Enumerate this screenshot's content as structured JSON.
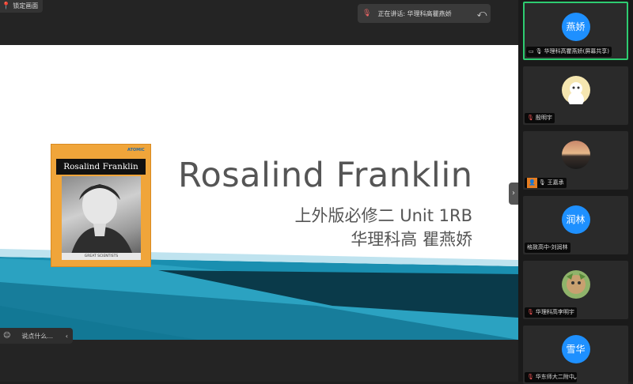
{
  "top_left": {
    "label": "锁定画面"
  },
  "speaking": {
    "label": "正在讲话: 华理科高瞿燕娇"
  },
  "slide": {
    "title": "Rosalind Franklin",
    "subtitle_line1": "上外版必修二 Unit 1RB",
    "subtitle_line2": "华理科高 瞿燕娇",
    "book": {
      "banner": "Rosalind Franklin",
      "tag": "ATOMIC",
      "caption": "GREAT SCIENTISTS"
    }
  },
  "chat": {
    "label": "说点什么..."
  },
  "participants": [
    {
      "avatar_text": "燕娇",
      "avatar_color": "#1e90ff",
      "name": "华理科高瞿燕娇(屏幕共享)",
      "active": true
    },
    {
      "avatar_text": "",
      "avatar_color": "#f5e6b0",
      "name": "殷明宇",
      "active": false
    },
    {
      "avatar_text": "",
      "avatar_color": "#c98a4a",
      "name": "王嘉承",
      "active": false
    },
    {
      "avatar_text": "润林",
      "avatar_color": "#1e90ff",
      "name": "格致高中-刘润林",
      "active": false
    },
    {
      "avatar_text": "",
      "avatar_color": "#7a9a4a",
      "name": "华理科高李明宇",
      "active": false
    },
    {
      "avatar_text": "雪华",
      "avatar_color": "#1e90ff",
      "name": "华东师大二附中",
      "active": false
    }
  ],
  "colors": {
    "accent_active": "#2ecc71",
    "slide_band": "#1a8fb0"
  }
}
